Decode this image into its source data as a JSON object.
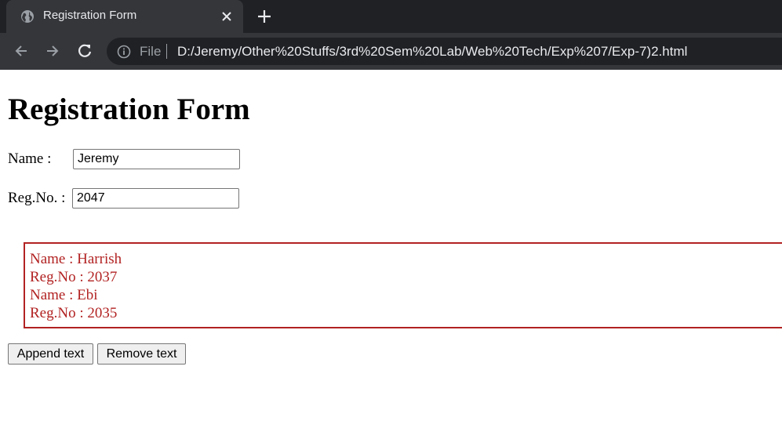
{
  "browser": {
    "tab_title": "Registration Form",
    "scheme_label": "File",
    "url": "D:/Jeremy/Other%20Stuffs/3rd%20Sem%20Lab/Web%20Tech/Exp%207/Exp-7)2.html"
  },
  "page": {
    "title": "Registration Form",
    "name_label": "Name :",
    "name_value": "Jeremy",
    "reg_label": "Reg.No. :",
    "reg_value": "2047",
    "output_lines": [
      "Name : Harrish",
      "Reg.No : 2037",
      "Name : Ebi",
      "Reg.No : 2035"
    ],
    "append_button": "Append text",
    "remove_button": "Remove text"
  },
  "colors": {
    "chrome_dark": "#202124",
    "chrome_tab": "#35363a",
    "output_red": "#b22222"
  }
}
